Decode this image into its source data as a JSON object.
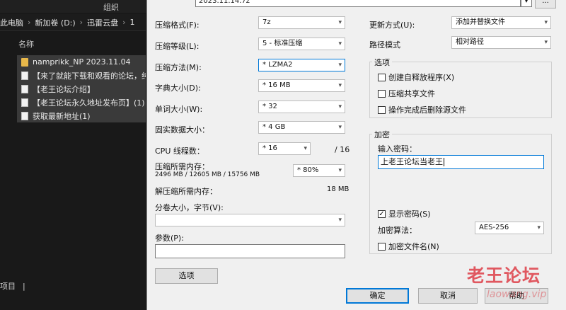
{
  "explorer": {
    "group_label": "组织",
    "breadcrumb": [
      "此电脑",
      "新加卷 (D:)",
      "迅雷云盘",
      "1"
    ],
    "column_name": "名称",
    "files": [
      {
        "name": "namprikk_NP 2023.11.04",
        "icon": "folder-icon"
      },
      {
        "name": "【来了就能下载和观看的论坛，纯免",
        "icon": "document-icon"
      },
      {
        "name": "【老王论坛介绍】",
        "icon": "document-icon"
      },
      {
        "name": "【老王论坛永久地址发布页】(1)",
        "icon": "document-icon"
      },
      {
        "name": "获取最新地址(1)",
        "icon": "document-icon"
      }
    ],
    "status_text": "项目"
  },
  "dialog": {
    "archive_name": "2023.11.14.7z",
    "browse_label": "...",
    "labels": {
      "format": "压缩格式(F):",
      "level": "压缩等级(L):",
      "method": "压缩方法(M):",
      "dict": "字典大小(D):",
      "word": "单词大小(W):",
      "solid": "固实数据大小：",
      "threads": "CPU 线程数：",
      "threads_total": "/ 16",
      "mem_comp": "压缩所需内存：",
      "mem_comp_detail": "2496 MB / 12605 MB / 15756 MB",
      "mem_decomp": "解压缩所需内存：",
      "mem_decomp_value": "18 MB",
      "split": "分卷大小，字节(V):",
      "params": "参数(P):",
      "update": "更新方式(U):",
      "path_mode": "路径模式"
    },
    "values": {
      "format": "7z",
      "level": "5 - 标准压缩",
      "method": "* LZMA2",
      "dict": "* 16 MB",
      "word": "* 32",
      "solid": "* 4 GB",
      "threads": "* 16",
      "mem_percent": "* 80%",
      "split": "",
      "params": "",
      "update": "添加并替换文件",
      "path_mode": "相对路径"
    },
    "options_group": {
      "title": "选项",
      "sfx": "创建自释放程序(X)",
      "shared": "压缩共享文件",
      "delete_after": "操作完成后删除源文件"
    },
    "encryption": {
      "title": "加密",
      "password_label": "输入密码：",
      "password_value": "上老王论坛当老王",
      "show_password": "显示密码(S)",
      "method_label": "加密算法：",
      "method_value": "AES-256",
      "encrypt_names": "加密文件名(N)"
    },
    "buttons": {
      "options": "选项",
      "ok": "确定",
      "cancel": "取消",
      "help": "帮助"
    }
  },
  "watermark": {
    "text": "老王论坛",
    "url": "laowang.vip"
  },
  "colors": {
    "explorer_bg": "#191919",
    "dialog_bg": "#f0f0f0",
    "focus_blue": "#0078d7",
    "watermark_red": "#dc323c"
  }
}
